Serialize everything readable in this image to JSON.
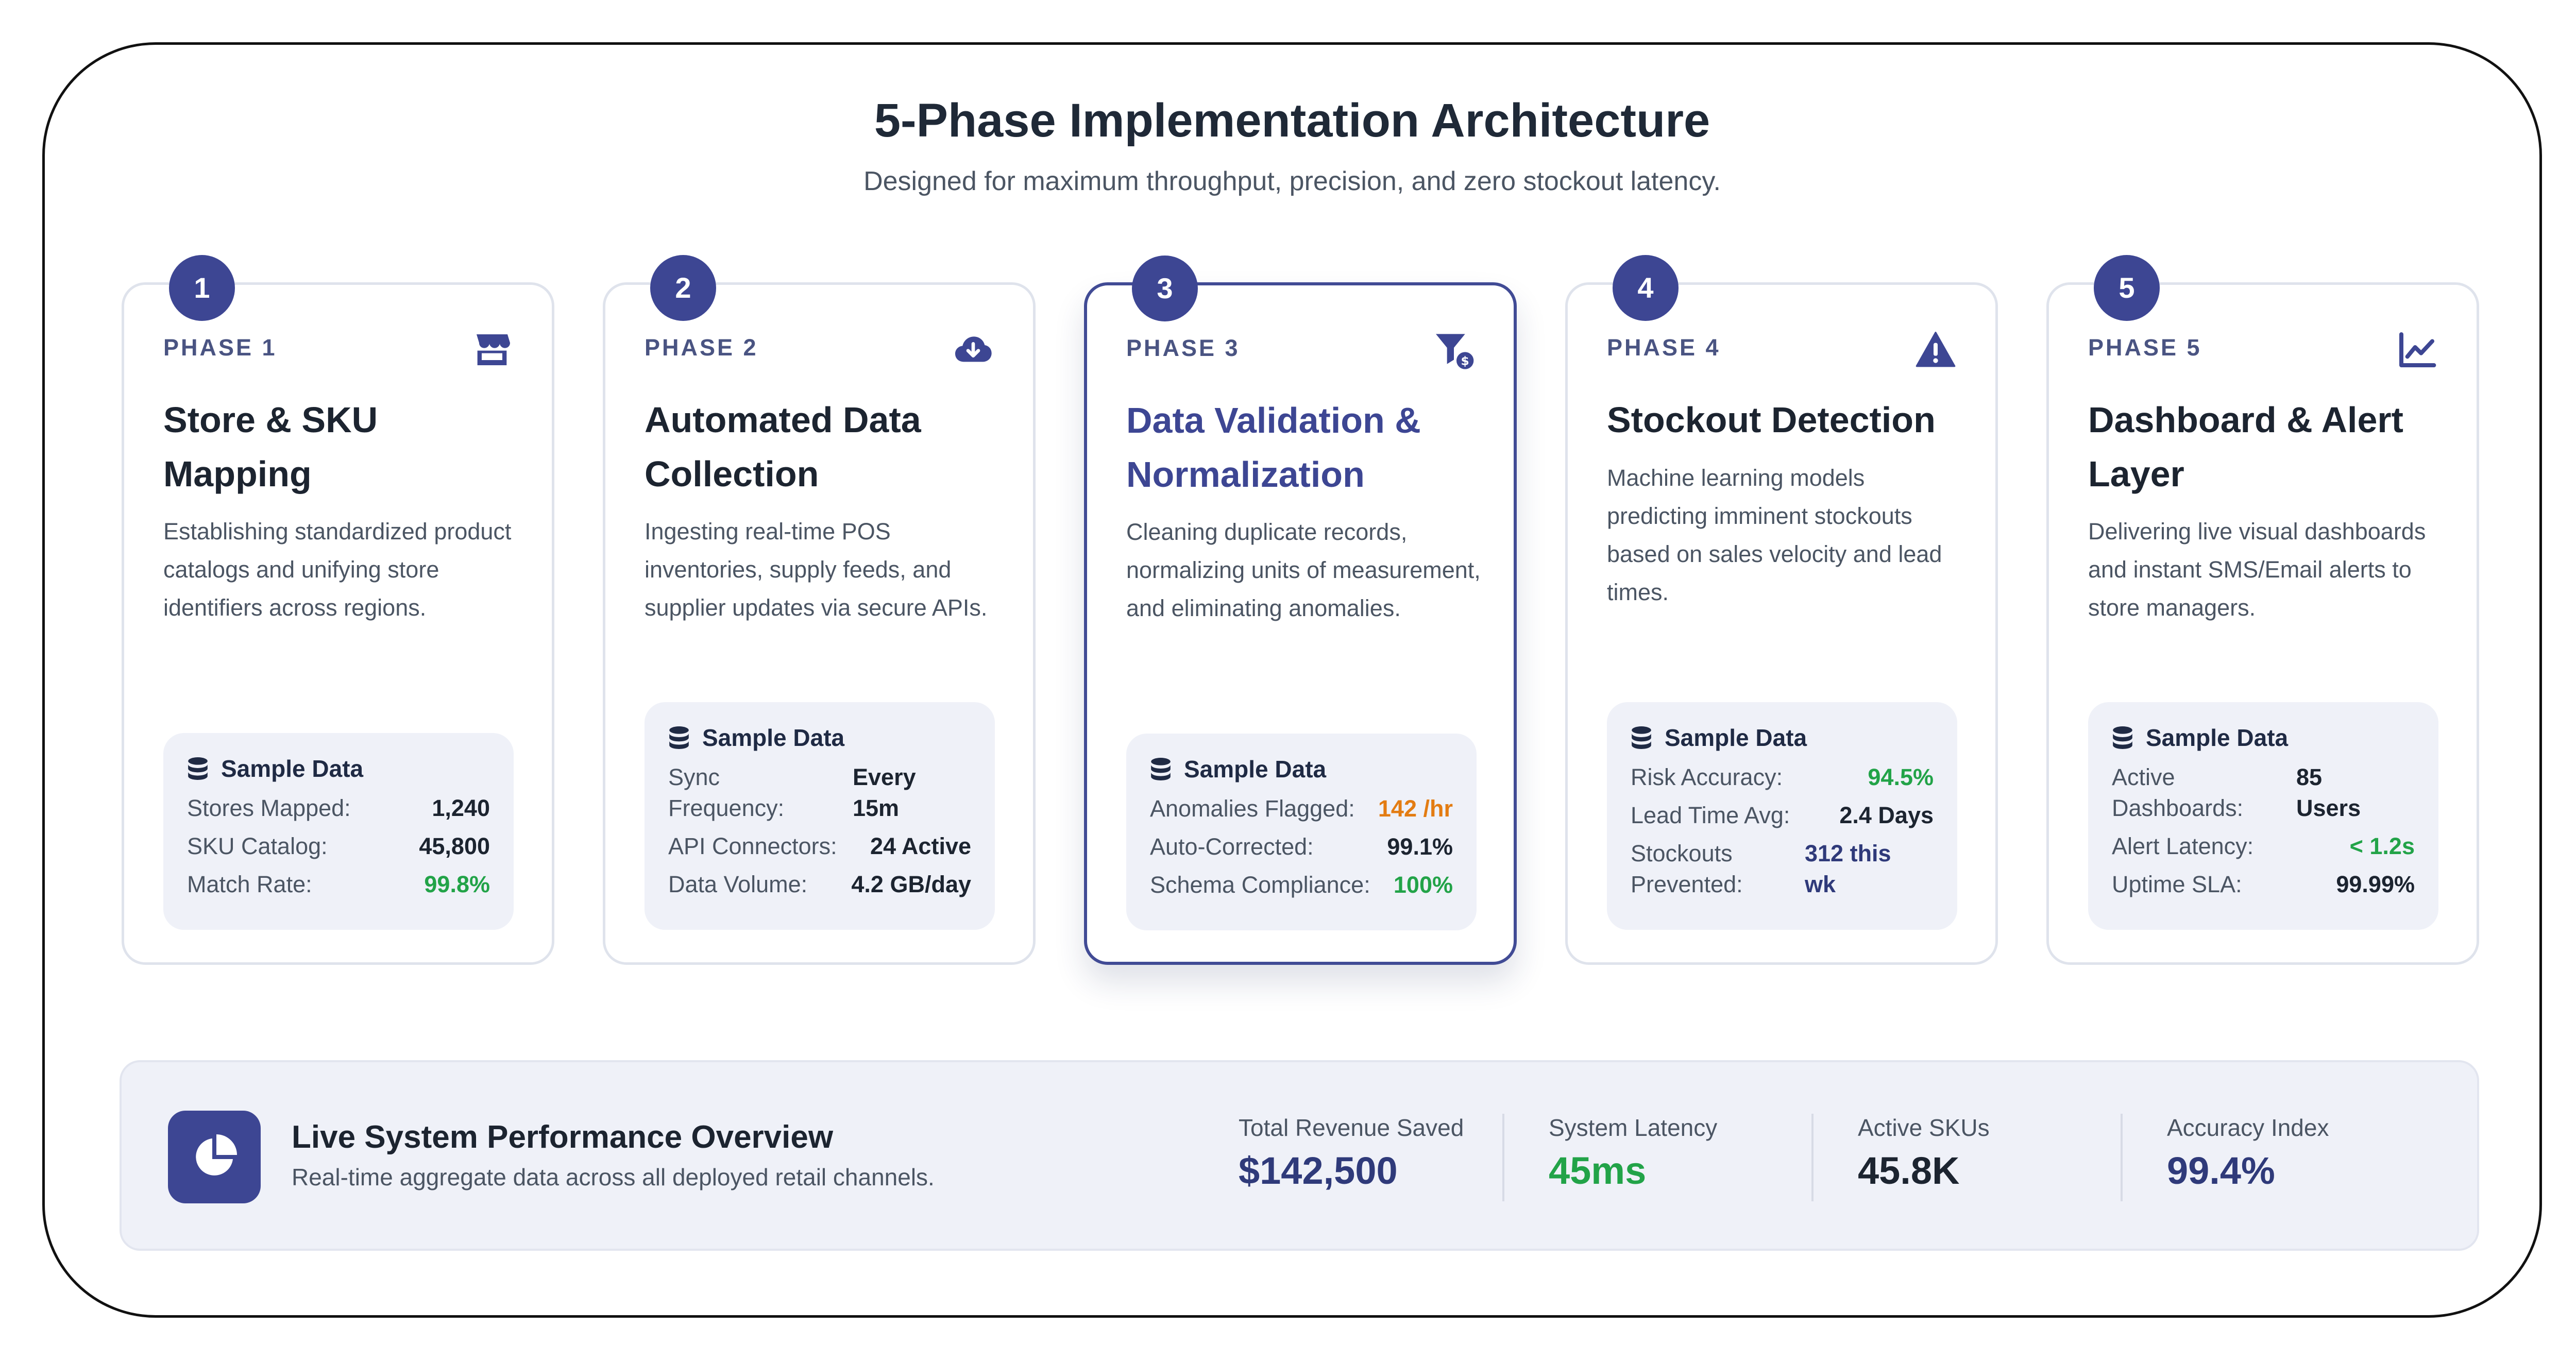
{
  "header": {
    "title": "5-Phase Implementation Architecture",
    "subtitle": "Designed for maximum throughput, precision, and zero stockout latency."
  },
  "phases": [
    {
      "number": "1",
      "phase_label": "PHASE 1",
      "icon": "store-icon",
      "title_line1": "Store & SKU",
      "title_line2": "Mapping",
      "description": "Establishing standardized product catalogs and unifying store identifiers across regions.",
      "sample_label": "Sample Data",
      "rows": [
        {
          "key": "Stores Mapped:",
          "value": "1,240"
        },
        {
          "key": "SKU Catalog:",
          "value": "45,800"
        },
        {
          "key": "Match Rate:",
          "value": "99.8%"
        }
      ]
    },
    {
      "number": "2",
      "phase_label": "PHASE 2",
      "icon": "cloud-download-icon",
      "title_line1": "Automated Data",
      "title_line2": "Collection",
      "description": "Ingesting real-time POS inventories, supply feeds, and supplier updates via secure APIs.",
      "sample_label": "Sample Data",
      "rows": [
        {
          "key_line1": "Sync",
          "key_line2": "Frequency:",
          "value_line1": "Every",
          "value_line2": "15m"
        },
        {
          "key": "API Connectors:",
          "value": "24 Active"
        },
        {
          "key": "Data Volume:",
          "value": "4.2 GB/day"
        }
      ]
    },
    {
      "number": "3",
      "phase_label": "PHASE 3",
      "icon": "filter-dollar-icon",
      "title_line1": "Data Validation &",
      "title_line2": "Normalization",
      "description": "Cleaning duplicate records, normalizing units of measurement, and eliminating anomalies.",
      "sample_label": "Sample Data",
      "rows": [
        {
          "key": "Anomalies Flagged:",
          "value": "142 /hr"
        },
        {
          "key": "Auto-Corrected:",
          "value": "99.1%"
        },
        {
          "key": "Schema Compliance:",
          "value": "100%"
        }
      ]
    },
    {
      "number": "4",
      "phase_label": "PHASE 4",
      "icon": "warning-icon",
      "title_line1": "Stockout Detection",
      "title_line2": "",
      "description": "Machine learning models predicting imminent stockouts based on sales velocity and lead times.",
      "sample_label": "Sample Data",
      "rows": [
        {
          "key": "Risk Accuracy:",
          "value": "94.5%"
        },
        {
          "key": "Lead Time Avg:",
          "value": "2.4 Days"
        },
        {
          "key_line1": "Stockouts",
          "key_line2": "Prevented:",
          "value_line1": "312 this",
          "value_line2": "wk"
        }
      ]
    },
    {
      "number": "5",
      "phase_label": "PHASE 5",
      "icon": "line-chart-icon",
      "title_line1": "Dashboard & Alert",
      "title_line2": "Layer",
      "description": "Delivering live visual dashboards and instant SMS/Email alerts to store managers.",
      "sample_label": "Sample Data",
      "rows": [
        {
          "key_line1": "Active",
          "key_line2": "Dashboards:",
          "value_line1": "85",
          "value_line2": "Users"
        },
        {
          "key": "Alert Latency:",
          "value": "< 1.2s"
        },
        {
          "key": "Uptime SLA:",
          "value": "99.99%"
        }
      ]
    }
  ],
  "performance": {
    "icon": "pie-chart-icon",
    "title": "Live System Performance Overview",
    "subtitle": "Real-time aggregate data across all deployed retail channels.",
    "metrics": [
      {
        "label": "Total Revenue Saved",
        "value": "$142,500"
      },
      {
        "label": "System Latency",
        "value": "45ms"
      },
      {
        "label": "Active SKUs",
        "value": "45.8K"
      },
      {
        "label": "Accuracy Index",
        "value": "99.4%"
      }
    ]
  },
  "colors": {
    "accent": "#3d4693",
    "green": "#22a348",
    "orange": "#e37c12",
    "text_dark": "#1c2430",
    "text_muted": "#4b5563",
    "panel_bg": "#eff1f8"
  }
}
